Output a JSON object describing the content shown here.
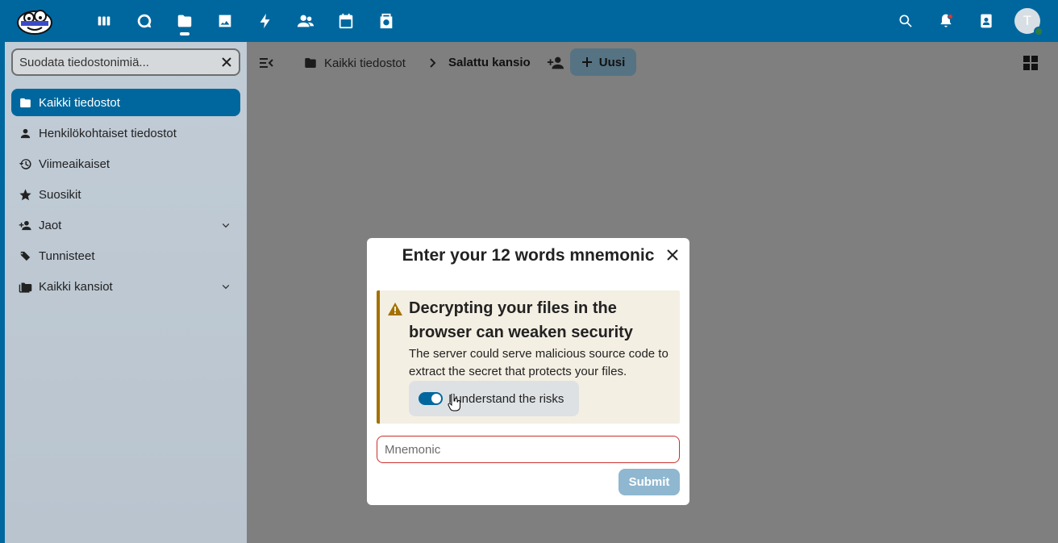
{
  "colors": {
    "primary": "#00679e",
    "sidebar_bg": "#c1ccd6",
    "overlay": "#7f7f7f",
    "warning_accent": "#a37200",
    "warning_bg": "#f4efe3",
    "error_border": "#c9302c",
    "submit_disabled": "#8fb7cf"
  },
  "header": {
    "apps": [
      {
        "icon": "dashboard-icon",
        "name": "app-dashboard",
        "active": false
      },
      {
        "icon": "talk-icon",
        "name": "app-talk",
        "active": false
      },
      {
        "icon": "files-icon",
        "name": "app-files",
        "active": true
      },
      {
        "icon": "photos-icon",
        "name": "app-photos",
        "active": false
      },
      {
        "icon": "activity-icon",
        "name": "app-activity",
        "active": false
      },
      {
        "icon": "contacts-icon",
        "name": "app-contacts",
        "active": false
      },
      {
        "icon": "calendar-icon",
        "name": "app-calendar",
        "active": false
      },
      {
        "icon": "end-to-end-icon",
        "name": "app-e2ee",
        "active": false
      }
    ],
    "avatar_letter": "T"
  },
  "sidebar": {
    "filter_placeholder": "Suodata tiedostonimiä...",
    "items": [
      {
        "label": "Kaikki tiedostot",
        "icon": "folder-icon",
        "active": true
      },
      {
        "label": "Henkilökohtaiset tiedostot",
        "icon": "account-icon",
        "active": false
      },
      {
        "label": "Viimeaikaiset",
        "icon": "history-icon",
        "active": false
      },
      {
        "label": "Suosikit",
        "icon": "star-icon",
        "active": false
      },
      {
        "label": "Jaot",
        "icon": "share-icon",
        "active": false,
        "expandable": true
      },
      {
        "label": "Tunnisteet",
        "icon": "tag-icon",
        "active": false
      },
      {
        "label": "Kaikki kansiot",
        "icon": "folders-icon",
        "active": false,
        "expandable": true
      }
    ]
  },
  "toolbar": {
    "breadcrumb_root": "Kaikki tiedostot",
    "breadcrumb_current": "Salattu kansio",
    "new_label": "Uusi"
  },
  "modal": {
    "title": "Enter your 12 words mnemonic",
    "warning_heading": "Decrypting your files in the browser can weaken security",
    "warning_body": "The server could serve malicious source code to extract the secret that protects your files.",
    "risk_toggle_label": "I understand the risks",
    "risk_toggle_checked": true,
    "mnemonic_placeholder": "Mnemonic",
    "mnemonic_value": "",
    "submit_label": "Submit"
  }
}
